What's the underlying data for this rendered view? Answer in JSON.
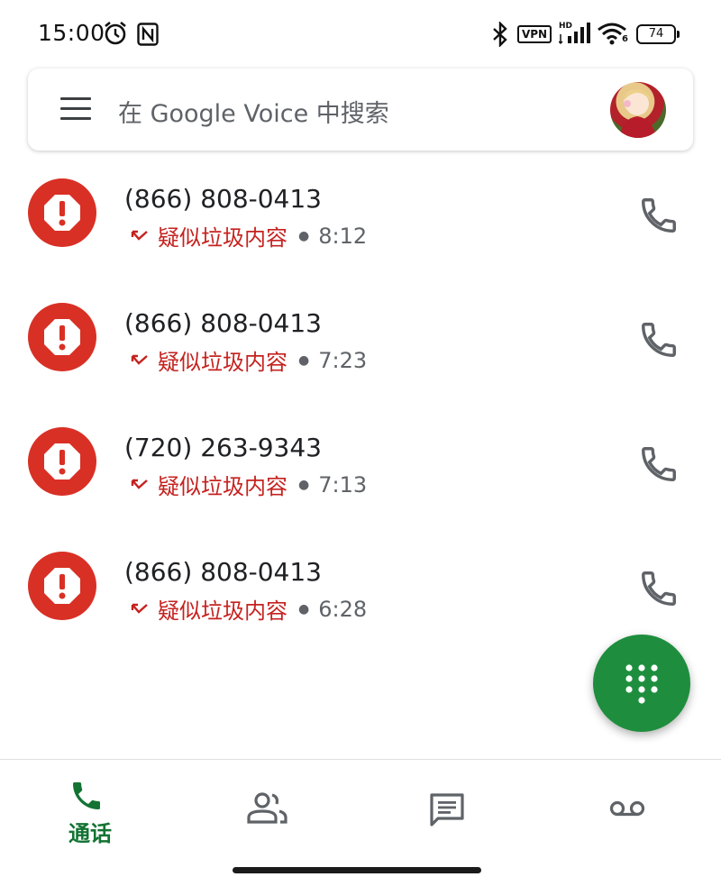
{
  "status_bar": {
    "time": "15:00",
    "vpn_label": "VPN",
    "signal_label": "HD",
    "wifi_label": "6",
    "battery": "74"
  },
  "search": {
    "placeholder": "在 Google Voice 中搜索"
  },
  "calls": [
    {
      "number": "(866) 808-0413",
      "label": "疑似垃圾内容",
      "time": "8:12"
    },
    {
      "number": "(866) 808-0413",
      "label": "疑似垃圾内容",
      "time": "7:23"
    },
    {
      "number": "(720) 263-9343",
      "label": "疑似垃圾内容",
      "time": "7:13"
    },
    {
      "number": "(866) 808-0413",
      "label": "疑似垃圾内容",
      "time": "6:28"
    }
  ],
  "nav": {
    "calls_label": "通话"
  },
  "colors": {
    "spam_red": "#d93025",
    "spam_text": "#c5221f",
    "accent_green": "#1e8e3e",
    "nav_active": "#137333"
  }
}
